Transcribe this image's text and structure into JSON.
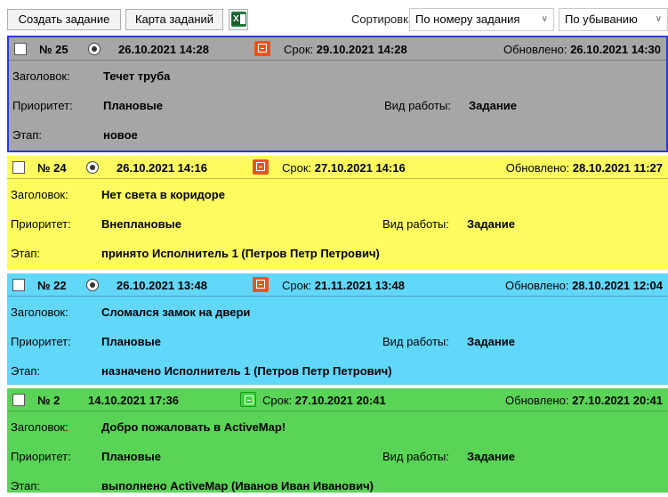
{
  "toolbar": {
    "create_label": "Создать задание",
    "map_label": "Карта заданий",
    "excel_icon": "excel-export-icon",
    "sort_label": "Сортировка",
    "sort_by": "По номеру задания",
    "sort_order": "По убыванию"
  },
  "labels": {
    "title": "Заголовок:",
    "priority": "Приоритет:",
    "work_type": "Вид работы:",
    "stage": "Этап:",
    "deadline": "Срок: ",
    "updated": "Обновлено: "
  },
  "cards": [
    {
      "number": "№ 25",
      "created": "26.10.2021 14:28",
      "deadline": "29.10.2021 14:28",
      "updated": "26.10.2021 14:30",
      "title": "Течет труба",
      "priority": "Плановые",
      "work_type": "Задание",
      "stage": "новое",
      "bg": "#a6a6a6",
      "selected": true,
      "icon": "task-orange-icon"
    },
    {
      "number": "№ 24",
      "created": "26.10.2021 14:16",
      "deadline": "27.10.2021 14:16",
      "updated": "28.10.2021 11:27",
      "title": "Нет света в коридоре",
      "priority": "Внеплановые",
      "work_type": "Задание",
      "stage": "принято Исполнитель 1 (Петров Петр Петрович)",
      "bg": "#fdfb5e",
      "icon": "task-orange-icon"
    },
    {
      "number": "№ 22",
      "created": "26.10.2021 13:48",
      "deadline": "21.11.2021 13:48",
      "updated": "28.10.2021 12:04",
      "title": "Сломался замок на двери",
      "priority": "Плановые",
      "work_type": "Задание",
      "stage": "назначено Исполнитель 1 (Петров Петр Петрович)",
      "bg": "#61d7fa",
      "icon": "task-orange-icon"
    },
    {
      "number": "№ 2",
      "created": "14.10.2021 17:36",
      "deadline": "27.10.2021 20:41",
      "updated": "27.10.2021 20:41",
      "title": "Добро пожаловать в ActiveMap!",
      "priority": "Плановые",
      "work_type": "Задание",
      "stage": "выполнено ActiveMap (Иванов Иван Иванович)",
      "bg": "#5ad456",
      "icon": "task-green-icon"
    }
  ]
}
